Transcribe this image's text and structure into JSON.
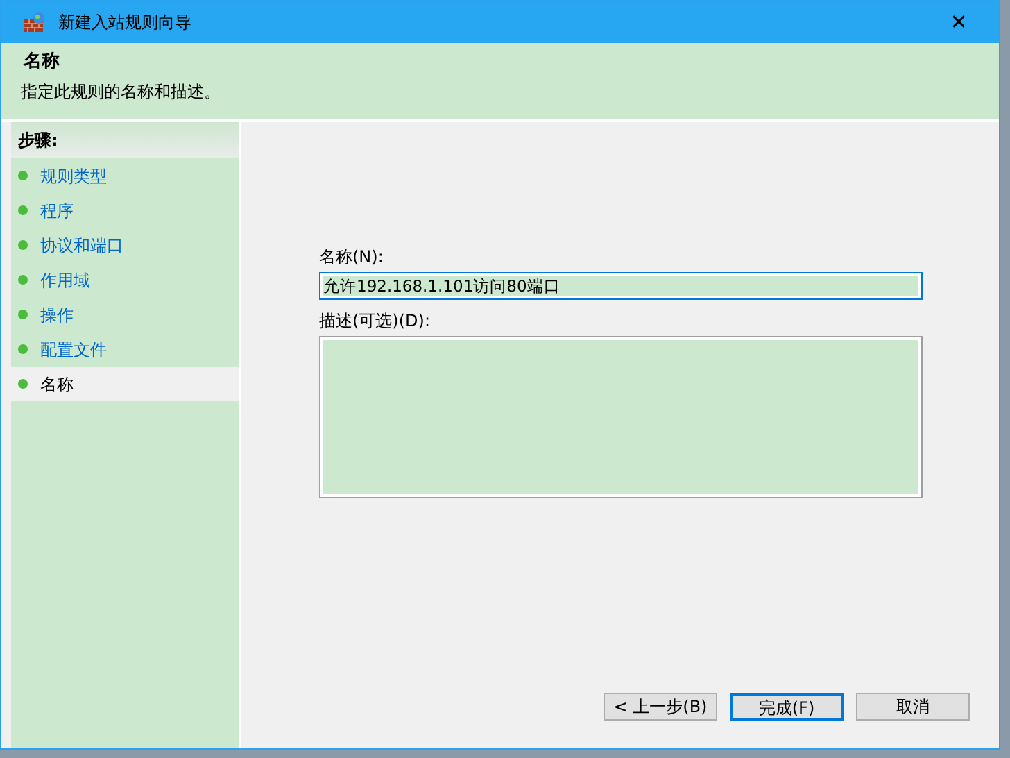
{
  "window": {
    "title": "新建入站规则向导",
    "close": "✕"
  },
  "header": {
    "title": "名称",
    "subtitle": "指定此规则的名称和描述。"
  },
  "sidebar": {
    "heading": "步骤:",
    "items": [
      {
        "label": "规则类型",
        "selected": false
      },
      {
        "label": "程序",
        "selected": false
      },
      {
        "label": "协议和端口",
        "selected": false
      },
      {
        "label": "作用域",
        "selected": false
      },
      {
        "label": "操作",
        "selected": false
      },
      {
        "label": "配置文件",
        "selected": false
      },
      {
        "label": "名称",
        "selected": true
      }
    ]
  },
  "form": {
    "name_label": "名称(N):",
    "name_value": "允许192.168.1.101访问80端口",
    "description_label": "描述(可选)(D):"
  },
  "buttons": [
    {
      "label": "< 上一步(B)",
      "selected": false
    },
    {
      "label": "完成(F)",
      "selected": true
    },
    {
      "label": "取消",
      "selected": false
    }
  ]
}
